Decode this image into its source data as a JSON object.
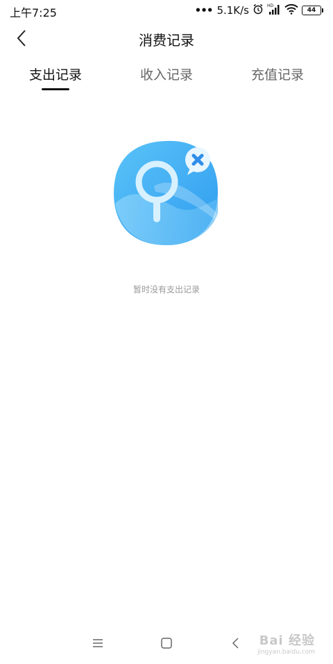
{
  "status_bar": {
    "time": "上午7:25",
    "net_speed": "5.1K/s",
    "hd_label": "HD",
    "battery": "44"
  },
  "header": {
    "title": "消费记录"
  },
  "tabs": [
    {
      "label": "支出记录",
      "active": true
    },
    {
      "label": "收入记录",
      "active": false
    },
    {
      "label": "充值记录",
      "active": false
    }
  ],
  "empty_state": {
    "message": "暂时没有支出记录"
  },
  "watermark": {
    "logo": "Bai 经验",
    "url": "jingyan.baidu.com"
  },
  "colors": {
    "accent": "#111111",
    "illustration": "#4fb6f5"
  }
}
